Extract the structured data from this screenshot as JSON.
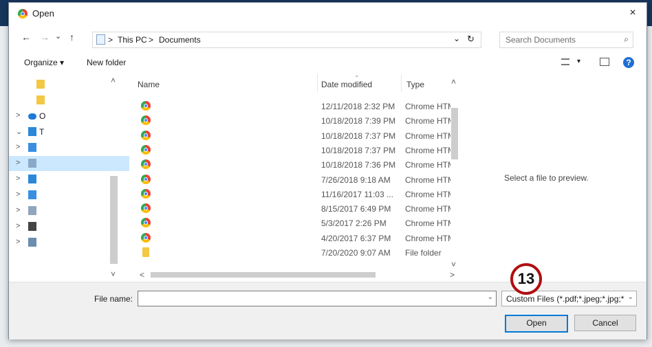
{
  "dialog": {
    "title": "Open",
    "close": "×"
  },
  "address": {
    "back": "←",
    "forward": "→",
    "recent": "⌄",
    "up": "↑",
    "sep1": ">",
    "this_pc": "This PC",
    "sep2": ">",
    "documents": "Documents",
    "dropdown": "⌄",
    "refresh": "↻",
    "search_placeholder": "Search Documents",
    "search_icon": "⌕"
  },
  "toolbar": {
    "organize": "Organize ▾",
    "new_folder": "New folder",
    "view_menu": "▾",
    "help": "?"
  },
  "nav_items": [
    {
      "label": "",
      "icon": "folder-icon",
      "chev": ""
    },
    {
      "label": "",
      "icon": "folder-icon",
      "chev": ""
    },
    {
      "label": "O",
      "icon": "onedrive-icon",
      "chev": ">"
    },
    {
      "label": "T",
      "icon": "this-pc-icon",
      "chev": "⌄"
    },
    {
      "label": "",
      "icon": "desktop-icon",
      "chev": ">"
    },
    {
      "label": "",
      "icon": "documents-icon",
      "chev": ">"
    },
    {
      "label": "",
      "icon": "downloads-icon",
      "chev": ">"
    },
    {
      "label": "",
      "icon": "music-icon",
      "chev": ">"
    },
    {
      "label": "",
      "icon": "pictures-icon",
      "chev": ">"
    },
    {
      "label": "",
      "icon": "videos-icon",
      "chev": ">"
    },
    {
      "label": "",
      "icon": "network-drive-icon",
      "chev": ">"
    }
  ],
  "columns": {
    "name": "Name",
    "date": "Date modified",
    "type": "Type",
    "sort": "⌄"
  },
  "files": [
    {
      "icon": "chrome",
      "date": "12/11/2018 2:32 PM",
      "type": "Chrome HTML"
    },
    {
      "icon": "chrome",
      "date": "10/18/2018 7:39 PM",
      "type": "Chrome HTML"
    },
    {
      "icon": "chrome",
      "date": "10/18/2018 7:37 PM",
      "type": "Chrome HTML"
    },
    {
      "icon": "chrome",
      "date": "10/18/2018 7:37 PM",
      "type": "Chrome HTML"
    },
    {
      "icon": "chrome",
      "date": "10/18/2018 7:36 PM",
      "type": "Chrome HTML"
    },
    {
      "icon": "chrome",
      "date": "7/26/2018 9:18 AM",
      "type": "Chrome HTML"
    },
    {
      "icon": "chrome",
      "date": "11/16/2017 11:03 ...",
      "type": "Chrome HTML"
    },
    {
      "icon": "chrome",
      "date": "8/15/2017 6:49 PM",
      "type": "Chrome HTML"
    },
    {
      "icon": "chrome",
      "date": "5/3/2017 2:26 PM",
      "type": "Chrome HTML"
    },
    {
      "icon": "chrome",
      "date": "4/20/2017 6:37 PM",
      "type": "Chrome HTML"
    },
    {
      "icon": "folder",
      "date": "7/20/2020 9:07 AM",
      "type": "File folder"
    }
  ],
  "scroll": {
    "up": "˄",
    "down": "˅",
    "left": "<",
    "right": ">"
  },
  "preview_text": "Select a file to preview.",
  "bottom": {
    "file_name_label": "File name:",
    "file_name_value": "",
    "dropdown": "⌄",
    "file_type": "Custom Files (*.pdf;*.jpeg;*.jpg;*",
    "open": "Open",
    "cancel": "Cancel"
  },
  "step_badge": "13",
  "colors": {
    "accent": "#0078d7",
    "badge_ring": "#b00e12",
    "selection": "#cce8ff"
  }
}
